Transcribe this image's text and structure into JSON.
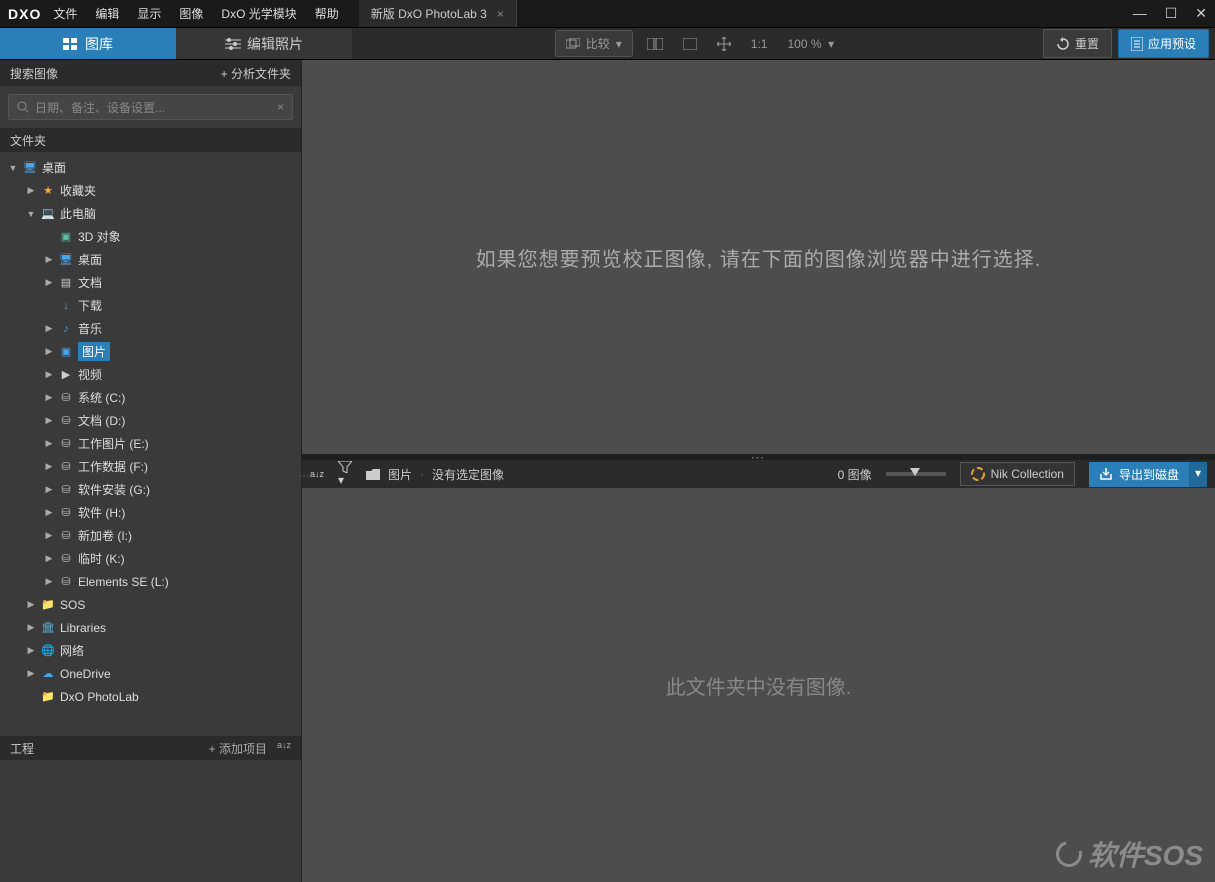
{
  "logo": "DXO",
  "menu": [
    "文件",
    "编辑",
    "显示",
    "图像",
    "DxO 光学模块",
    "帮助"
  ],
  "tab": {
    "title": "新版 DxO PhotoLab 3"
  },
  "modes": {
    "library": "图库",
    "edit": "编辑照片"
  },
  "toolbar": {
    "compare": "比较",
    "ratio": "1:1",
    "zoom": "100 %",
    "reset": "重置",
    "apply_preset": "应用预设"
  },
  "search": {
    "header": "搜索图像",
    "analyze": "+ 分析文件夹",
    "placeholder": "日期、备注、设备设置..."
  },
  "folders": {
    "header": "文件夹"
  },
  "tree": [
    {
      "label": "桌面",
      "depth": 0,
      "arrow": "down",
      "icon": "monitor"
    },
    {
      "label": "收藏夹",
      "depth": 1,
      "arrow": "right",
      "icon": "star"
    },
    {
      "label": "此电脑",
      "depth": 1,
      "arrow": "down",
      "icon": "pc"
    },
    {
      "label": "3D 对象",
      "depth": 2,
      "arrow": "blank",
      "icon": "3d"
    },
    {
      "label": "桌面",
      "depth": 2,
      "arrow": "right",
      "icon": "monitor"
    },
    {
      "label": "文档",
      "depth": 2,
      "arrow": "right",
      "icon": "doc"
    },
    {
      "label": "下载",
      "depth": 2,
      "arrow": "blank",
      "icon": "down"
    },
    {
      "label": "音乐",
      "depth": 2,
      "arrow": "right",
      "icon": "music"
    },
    {
      "label": "图片",
      "depth": 2,
      "arrow": "right",
      "icon": "pic",
      "selected": true
    },
    {
      "label": "视频",
      "depth": 2,
      "arrow": "right",
      "icon": "video"
    },
    {
      "label": "系统 (C:)",
      "depth": 2,
      "arrow": "right",
      "icon": "drive"
    },
    {
      "label": "文档 (D:)",
      "depth": 2,
      "arrow": "right",
      "icon": "drive"
    },
    {
      "label": "工作图片 (E:)",
      "depth": 2,
      "arrow": "right",
      "icon": "drive"
    },
    {
      "label": "工作数据 (F:)",
      "depth": 2,
      "arrow": "right",
      "icon": "drive"
    },
    {
      "label": "软件安装 (G:)",
      "depth": 2,
      "arrow": "right",
      "icon": "drive"
    },
    {
      "label": "软件 (H:)",
      "depth": 2,
      "arrow": "right",
      "icon": "drive"
    },
    {
      "label": "新加卷 (I:)",
      "depth": 2,
      "arrow": "right",
      "icon": "drive"
    },
    {
      "label": "临时 (K:)",
      "depth": 2,
      "arrow": "right",
      "icon": "drive"
    },
    {
      "label": "Elements SE (L:)",
      "depth": 2,
      "arrow": "right",
      "icon": "drive"
    },
    {
      "label": "SOS",
      "depth": 1,
      "arrow": "right",
      "icon": "folder"
    },
    {
      "label": "Libraries",
      "depth": 1,
      "arrow": "right",
      "icon": "lib"
    },
    {
      "label": "网络",
      "depth": 1,
      "arrow": "right",
      "icon": "net"
    },
    {
      "label": "OneDrive",
      "depth": 1,
      "arrow": "right",
      "icon": "cloud"
    },
    {
      "label": "DxO PhotoLab",
      "depth": 1,
      "arrow": "blank",
      "icon": "folder"
    }
  ],
  "projects": {
    "header": "工程",
    "add": "+ 添加项目",
    "sort": "a↓z"
  },
  "preview": {
    "empty": "如果您想要预览校正图像, 请在下面的图像浏览器中进行选择."
  },
  "browser": {
    "sort": "a↓z",
    "filter": "▼",
    "path_label": "图片",
    "no_selection": "没有选定图像",
    "count": "0 图像",
    "nik": "Nik Collection",
    "export": "导出到磁盘",
    "empty": "此文件夹中没有图像."
  },
  "watermark": "软件SOS"
}
